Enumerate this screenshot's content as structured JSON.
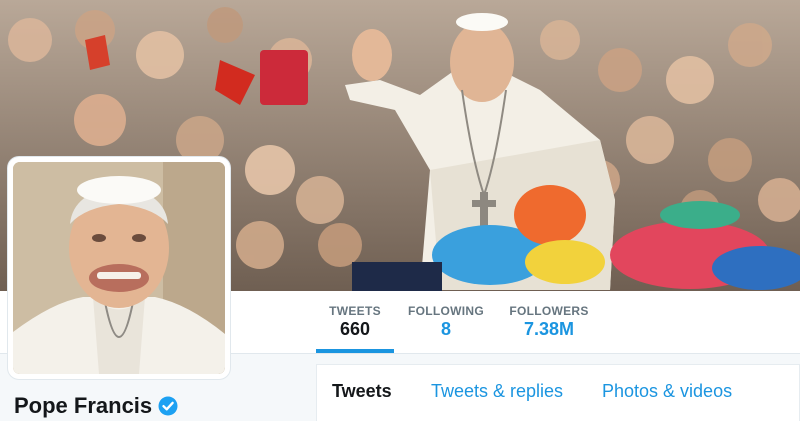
{
  "profile": {
    "name": "Pope Francis",
    "verified": true
  },
  "stats": [
    {
      "label": "TWEETS",
      "value": "660",
      "active": true
    },
    {
      "label": "FOLLOWING",
      "value": "8",
      "active": false
    },
    {
      "label": "FOLLOWERS",
      "value": "7.38M",
      "active": false
    }
  ],
  "tabs": [
    {
      "label": "Tweets",
      "active": true
    },
    {
      "label": "Tweets & replies",
      "active": false
    },
    {
      "label": "Photos & videos",
      "active": false
    }
  ],
  "colors": {
    "accent": "#1b95e0",
    "text_dark": "#14171a",
    "text_muted": "#66757f",
    "background": "#f5f8fa",
    "verified": "#1da1f2"
  },
  "icons": {
    "verified": "verified-badge-icon"
  }
}
